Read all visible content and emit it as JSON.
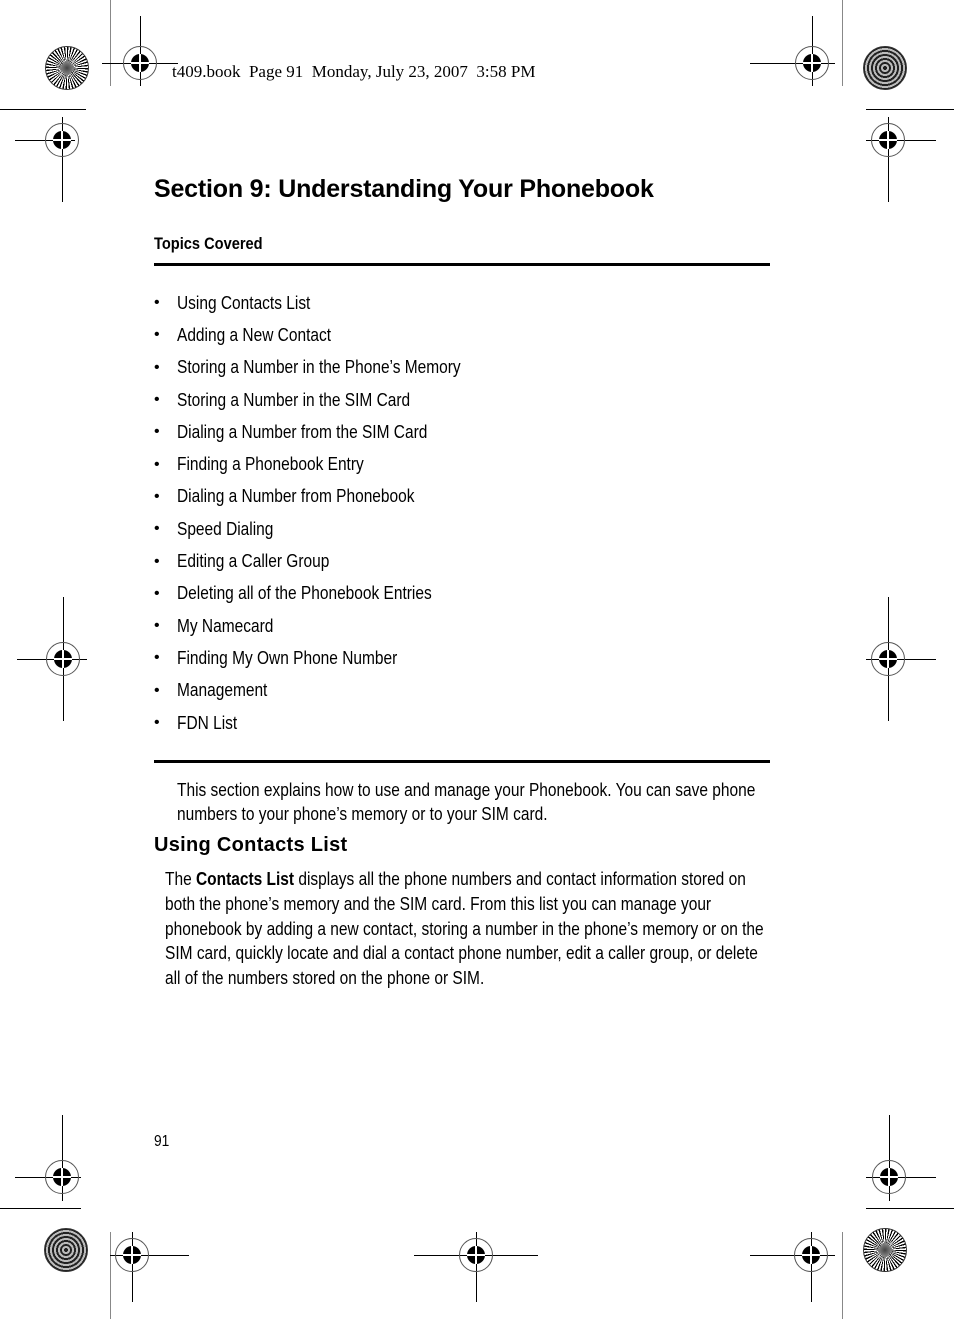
{
  "header_stamp": "t409.book  Page 91  Monday, July 23, 2007  3:58 PM",
  "section_title": "Section 9: Understanding Your Phonebook",
  "topics_heading": "Topics Covered",
  "topics": [
    "Using Contacts List",
    "Adding a New Contact",
    "Storing a Number in the Phone’s Memory",
    "Storing a Number in the SIM Card",
    "Dialing a Number from the SIM Card",
    "Finding a Phonebook Entry",
    "Dialing a Number from Phonebook",
    "Speed Dialing",
    "Editing a Caller Group",
    "Deleting all of the Phonebook Entries",
    "My Namecard",
    "Finding My Own Phone Number",
    "Management",
    "FDN List"
  ],
  "bullet_glyph": "•",
  "intro": "This section explains how to use and manage your Phonebook. You can save phone numbers to your phone’s memory or to your SIM card.",
  "subsection": {
    "title": "Using Contacts List",
    "para_prefix": "The ",
    "para_bold": "Contacts List",
    "para_rest": " displays all the phone numbers and contact information stored on both the phone’s memory and the SIM card. From this list you can manage your phonebook by adding a new contact, storing a number in the phone’s memory or on the SIM card, quickly locate and dial a contact phone number, edit a caller group, or delete all of the numbers stored on the phone or SIM."
  },
  "page_number": "91",
  "marks": {
    "registration_icon": "crosshair-registration-mark",
    "starburst_icon": "starburst-color-bar",
    "moire_icon": "moire-color-bar"
  }
}
